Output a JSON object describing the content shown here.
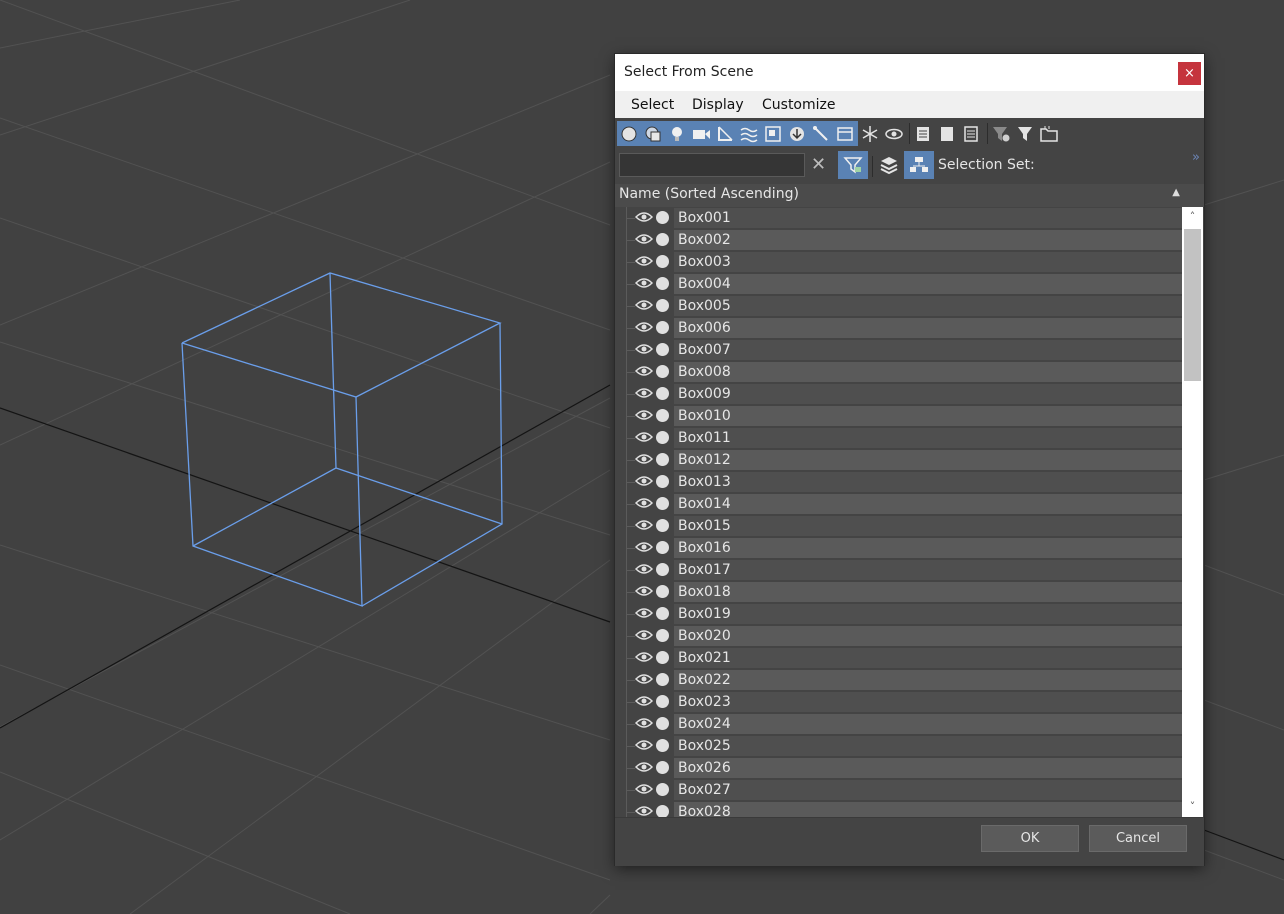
{
  "dialog": {
    "title": "Select From Scene",
    "close_glyph": "×",
    "menu": [
      "Select",
      "Display",
      "Customize"
    ],
    "toolbar1": {
      "object_type_icons": [
        "geometry-icon",
        "shapes-icon",
        "lights-icon",
        "cameras-icon",
        "helpers-icon",
        "space-warps-icon",
        "groups-icon",
        "xrefs-icon",
        "bones-icon",
        "containers-icon"
      ],
      "extra_icons": [
        "frozen-icon",
        "hidden-icon",
        "list-all-icon",
        "list-none-icon",
        "list-invert-icon",
        "filter-settings-icon",
        "filter-icon",
        "folder-icon"
      ]
    },
    "toolbar2": {
      "search_value": "",
      "clear_glyph": "✕",
      "selection_set_label": "Selection Set:",
      "more_glyph": "»"
    },
    "list_header": "Name (Sorted Ascending)",
    "sort_glyph": "▲",
    "objects": [
      "Box001",
      "Box002",
      "Box003",
      "Box004",
      "Box005",
      "Box006",
      "Box007",
      "Box008",
      "Box009",
      "Box010",
      "Box011",
      "Box012",
      "Box013",
      "Box014",
      "Box015",
      "Box016",
      "Box017",
      "Box018",
      "Box019",
      "Box020",
      "Box021",
      "Box022",
      "Box023",
      "Box024",
      "Box025",
      "Box026",
      "Box027",
      "Box028"
    ],
    "scroll_up_glyph": "˄",
    "scroll_down_glyph": "˅",
    "ok_label": "OK",
    "cancel_label": "Cancel"
  },
  "colors": {
    "viewport_bg": "#414141",
    "grid": "#525252",
    "axis": "#141414",
    "box_wire": "#6a9eea",
    "accent": "#5a82b4"
  }
}
